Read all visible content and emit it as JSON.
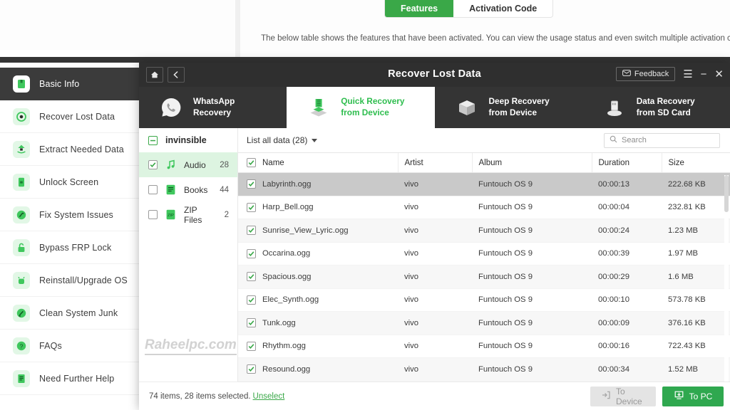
{
  "background": {
    "tabs": [
      {
        "label": "Features",
        "active": true
      },
      {
        "label": "Activation Code",
        "active": false
      }
    ],
    "description": "The below table shows the features that have been activated. You can view the usage status and even switch multiple activation codes."
  },
  "sidebar": {
    "items": [
      {
        "label": "Basic Info",
        "icon": "book-icon",
        "active": true
      },
      {
        "label": "Recover Lost Data",
        "icon": "target-icon",
        "active": false
      },
      {
        "label": "Extract Needed Data",
        "icon": "extract-icon",
        "active": false
      },
      {
        "label": "Unlock Screen",
        "icon": "phone-lock-icon",
        "active": false
      },
      {
        "label": "Fix System Issues",
        "icon": "wrench-icon",
        "active": false
      },
      {
        "label": "Bypass FRP Lock",
        "icon": "lock-open-icon",
        "active": false
      },
      {
        "label": "Reinstall/Upgrade OS",
        "icon": "android-icon",
        "active": false
      },
      {
        "label": "Clean System Junk",
        "icon": "broom-icon",
        "active": false
      },
      {
        "label": "FAQs",
        "icon": "question-icon",
        "active": false
      },
      {
        "label": "Need Further Help",
        "icon": "document-icon",
        "active": false
      }
    ]
  },
  "dialog": {
    "title": "Recover Lost Data",
    "titlebar": {
      "home_icon": "home-icon",
      "back_icon": "chevron-left-icon",
      "feedback_label": "Feedback",
      "feedback_icon": "envelope-icon",
      "menu_icon": "hamburger-icon",
      "minimize_icon": "minimize-icon",
      "close_icon": "close-icon"
    },
    "modes": [
      {
        "line1": "WhatsApp",
        "line2": "Recovery",
        "icon": "whatsapp-icon",
        "active": false
      },
      {
        "line1": "Quick Recovery",
        "line2": "from Device",
        "icon": "cube-layers-icon",
        "active": true
      },
      {
        "line1": "Deep Recovery",
        "line2": "from Device",
        "icon": "open-box-icon",
        "active": false
      },
      {
        "line1": "Data Recovery",
        "line2": "from SD Card",
        "icon": "sd-card-icon",
        "active": false
      }
    ],
    "categories": {
      "header_label": "invinsible",
      "header_checkbox": "indeterminate",
      "items": [
        {
          "label": "Audio",
          "count": "28",
          "checked": true,
          "icon": "music-note-icon",
          "active": true
        },
        {
          "label": "Books",
          "count": "44",
          "checked": false,
          "icon": "book-file-icon",
          "active": false
        },
        {
          "label": "ZIP Files",
          "count": "2",
          "checked": false,
          "icon": "zip-file-icon",
          "active": false
        }
      ]
    },
    "watermark": "Raheelpc.com",
    "filelist": {
      "list_all_label": "List all data (28)",
      "search_placeholder": "Search",
      "search_icon": "search-icon",
      "columns": [
        "Name",
        "Artist",
        "Album",
        "Duration",
        "Size"
      ],
      "header_checked": true,
      "rows": [
        {
          "checked": true,
          "name": "Labyrinth.ogg",
          "artist": "vivo",
          "album": "Funtouch OS 9",
          "duration": "00:00:13",
          "size": "222.68 KB",
          "selected": true
        },
        {
          "checked": true,
          "name": "Harp_Bell.ogg",
          "artist": "vivo",
          "album": "Funtouch OS 9",
          "duration": "00:00:04",
          "size": "232.81 KB",
          "selected": false
        },
        {
          "checked": true,
          "name": "Sunrise_View_Lyric.ogg",
          "artist": "vivo",
          "album": "Funtouch OS 9",
          "duration": "00:00:24",
          "size": "1.23 MB",
          "selected": false
        },
        {
          "checked": true,
          "name": "Occarina.ogg",
          "artist": "vivo",
          "album": "Funtouch OS 9",
          "duration": "00:00:39",
          "size": "1.97 MB",
          "selected": false
        },
        {
          "checked": true,
          "name": "Spacious.ogg",
          "artist": "vivo",
          "album": "Funtouch OS 9",
          "duration": "00:00:29",
          "size": "1.6 MB",
          "selected": false
        },
        {
          "checked": true,
          "name": "Elec_Synth.ogg",
          "artist": "vivo",
          "album": "Funtouch OS 9",
          "duration": "00:00:10",
          "size": "573.78 KB",
          "selected": false
        },
        {
          "checked": true,
          "name": "Tunk.ogg",
          "artist": "vivo",
          "album": "Funtouch OS 9",
          "duration": "00:00:09",
          "size": "376.16 KB",
          "selected": false
        },
        {
          "checked": true,
          "name": "Rhythm.ogg",
          "artist": "vivo",
          "album": "Funtouch OS 9",
          "duration": "00:00:16",
          "size": "722.43 KB",
          "selected": false
        },
        {
          "checked": true,
          "name": "Resound.ogg",
          "artist": "vivo",
          "album": "Funtouch OS 9",
          "duration": "00:00:34",
          "size": "1.52 MB",
          "selected": false
        }
      ]
    },
    "footer": {
      "status": "74 items, 28 items selected.",
      "unselect_label": "Unselect",
      "to_device_label": "To Device",
      "to_device_icon": "export-device-icon",
      "to_pc_label": "To PC",
      "to_pc_icon": "download-pc-icon"
    }
  },
  "colors": {
    "accent_green": "#2fa84f",
    "tab_green": "#3aa848",
    "dark_bar": "#343434",
    "titlebar": "#2f2f2f",
    "row_selected": "#c9c9c9",
    "cat_active": "#ddf4e1"
  }
}
